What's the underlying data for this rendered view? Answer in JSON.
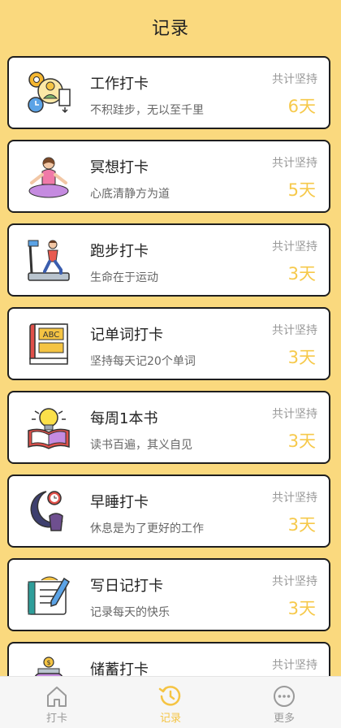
{
  "header": {
    "title": "记录"
  },
  "cards": [
    {
      "name": "工作打卡",
      "desc": "不积跬步，无以至千里",
      "total_label": "共计坚持",
      "days": "6天",
      "icon": "work-icon"
    },
    {
      "name": "冥想打卡",
      "desc": "心底清静方为道",
      "total_label": "共计坚持",
      "days": "5天",
      "icon": "meditation-icon"
    },
    {
      "name": "跑步打卡",
      "desc": "生命在于运动",
      "total_label": "共计坚持",
      "days": "3天",
      "icon": "treadmill-icon"
    },
    {
      "name": "记单词打卡",
      "desc": "坚持每天记20个单词",
      "total_label": "共计坚持",
      "days": "3天",
      "icon": "abc-book-icon"
    },
    {
      "name": "每周1本书",
      "desc": "读书百遍，其义自见",
      "total_label": "共计坚持",
      "days": "3天",
      "icon": "lightbulb-book-icon"
    },
    {
      "name": "早睡打卡",
      "desc": "休息是为了更好的工作",
      "total_label": "共计坚持",
      "days": "3天",
      "icon": "moon-clock-icon"
    },
    {
      "name": "写日记打卡",
      "desc": "记录每天的快乐",
      "total_label": "共计坚持",
      "days": "3天",
      "icon": "diary-pen-icon"
    },
    {
      "name": "储蓄打卡",
      "desc": "",
      "total_label": "共计坚持",
      "days": "",
      "icon": "savings-jar-icon"
    }
  ],
  "tabs": [
    {
      "label": "打卡",
      "icon": "home-icon"
    },
    {
      "label": "记录",
      "icon": "history-icon"
    },
    {
      "label": "更多",
      "icon": "more-icon"
    }
  ],
  "colors": {
    "background": "#FAD97E",
    "accent": "#F5C443",
    "card_border": "#1E1E1E"
  }
}
